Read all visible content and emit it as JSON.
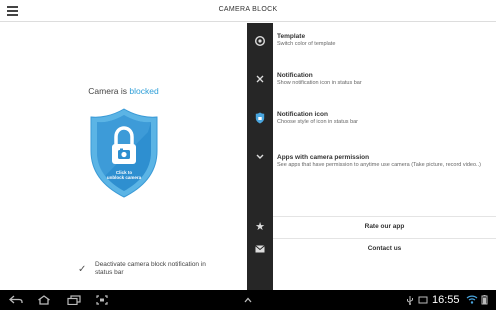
{
  "app": {
    "title": "CAMERA BLOCK"
  },
  "status": {
    "prefix": "Camera is ",
    "state": "blocked"
  },
  "shield": {
    "line1": "Click to",
    "line2": "unblock camera"
  },
  "deactivate": {
    "label": "Deactivate camera block notification in status bar",
    "checked": true
  },
  "settings": [
    {
      "title": "Template",
      "subtitle": "Switch color of template"
    },
    {
      "title": "Notification",
      "subtitle": "Show notification icon in status bar"
    },
    {
      "title": "Notification icon",
      "subtitle": "Choose style of icon in status bar"
    },
    {
      "title": "Apps with camera permission",
      "subtitle": "See apps that have permission to anytime use camera (Take picture, record video..)"
    }
  ],
  "links": {
    "rate": "Rate our app",
    "contact": "Contact us"
  },
  "system": {
    "time": "16:55"
  },
  "colors": {
    "accent": "#2f9fd8",
    "shield_outer": "#5bb4e5",
    "shield_inner": "#2e8fd0",
    "strip": "#262626"
  }
}
